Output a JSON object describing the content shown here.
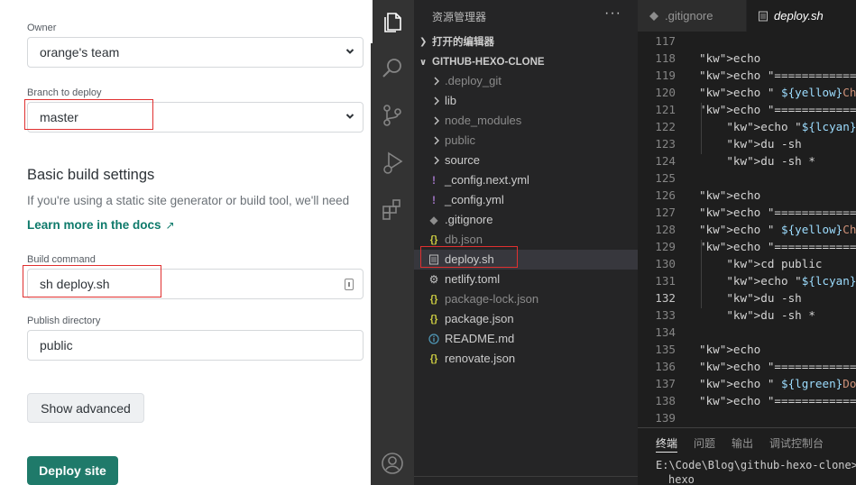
{
  "netlify": {
    "owner_label": "Owner",
    "owner_value": "orange's team",
    "branch_label": "Branch to deploy",
    "branch_value": "master",
    "basic_heading": "Basic build settings",
    "basic_desc": "If you're using a static site generator or build tool, we'll need",
    "learn_more": "Learn more in the docs",
    "learn_more_arrow": "↗",
    "build_command_label": "Build command",
    "build_command_value": "sh deploy.sh",
    "publish_dir_label": "Publish directory",
    "publish_dir_value": "public",
    "show_advanced": "Show advanced",
    "deploy_site": "Deploy site"
  },
  "vscode": {
    "explorer_title": "资源管理器",
    "explorer_more": "···",
    "open_editors": "打开的编辑器",
    "project": "GITHUB-HEXO-CLONE",
    "files": [
      {
        "name": ".deploy_git",
        "kind": "folder",
        "dim": true
      },
      {
        "name": "lib",
        "kind": "folder"
      },
      {
        "name": "node_modules",
        "kind": "folder",
        "dim": true
      },
      {
        "name": "public",
        "kind": "folder",
        "dim": true
      },
      {
        "name": "source",
        "kind": "folder"
      },
      {
        "name": "_config.next.yml",
        "kind": "yml"
      },
      {
        "name": "_config.yml",
        "kind": "yml"
      },
      {
        "name": ".gitignore",
        "kind": "git"
      },
      {
        "name": "db.json",
        "kind": "json",
        "dim": true
      },
      {
        "name": "deploy.sh",
        "kind": "sh",
        "selected": true
      },
      {
        "name": "netlify.toml",
        "kind": "toml"
      },
      {
        "name": "package-lock.json",
        "kind": "json",
        "dim": true
      },
      {
        "name": "package.json",
        "kind": "json"
      },
      {
        "name": "README.md",
        "kind": "md"
      },
      {
        "name": "renovate.json",
        "kind": "json"
      }
    ],
    "tabs": [
      {
        "label": ".gitignore",
        "active": false
      },
      {
        "label": "deploy.sh",
        "active": true
      }
    ],
    "code_lines": [
      {
        "n": "117",
        "t": ""
      },
      {
        "n": "118",
        "t": "echo"
      },
      {
        "n": "119",
        "t": "echo \"================="
      },
      {
        "n": "120",
        "t": "echo \" ${yellow}Checkin"
      },
      {
        "n": "121",
        "t": "echo \"================="
      },
      {
        "n": "122",
        "t": "    echo \"${lcyan}`pwd`"
      },
      {
        "n": "123",
        "t": "    du -sh"
      },
      {
        "n": "124",
        "t": "    du -sh *"
      },
      {
        "n": "125",
        "t": ""
      },
      {
        "n": "126",
        "t": "echo"
      },
      {
        "n": "127",
        "t": "echo \"================="
      },
      {
        "n": "128",
        "t": "echo \" ${yellow}Checkin"
      },
      {
        "n": "129",
        "t": "echo \"================="
      },
      {
        "n": "130",
        "t": "    cd public"
      },
      {
        "n": "131",
        "t": "    echo \"${lcyan}`pwd`"
      },
      {
        "n": "132",
        "t": "    du -sh"
      },
      {
        "n": "133",
        "t": "    du -sh *"
      },
      {
        "n": "134",
        "t": ""
      },
      {
        "n": "135",
        "t": "echo"
      },
      {
        "n": "136",
        "t": "echo \"================="
      },
      {
        "n": "137",
        "t": "echo \" ${lgreen}Done. E"
      },
      {
        "n": "138",
        "t": "echo \"================="
      },
      {
        "n": "139",
        "t": ""
      }
    ],
    "panel_tabs": [
      "终端",
      "问题",
      "输出",
      "调试控制台"
    ],
    "terminal_line1": "E:\\Code\\Blog\\github-hexo-clone>g",
    "terminal_line2": "hexo",
    "colors": {
      "accent": "#007acc",
      "selection_box": "#e03030",
      "netlify_green": "#1f7a6a"
    }
  }
}
